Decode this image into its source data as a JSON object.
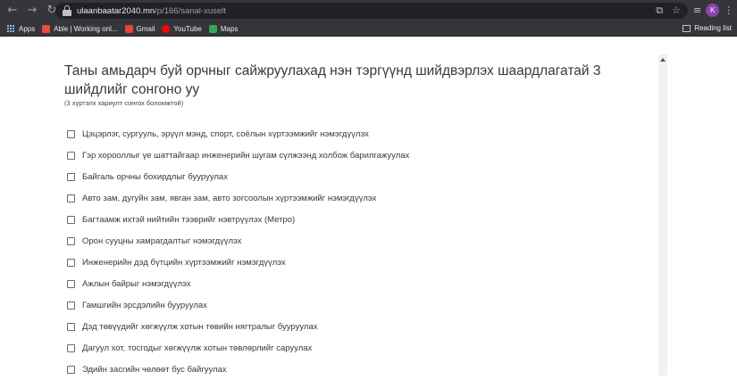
{
  "browser": {
    "url_host": "ulaanbaatar2040.mn",
    "url_path": "/p/166/sanal-xuselt",
    "profile_initial": "K",
    "bookmarks": [
      {
        "label": "Apps",
        "icon": "apps-grid-icon"
      },
      {
        "label": "Able | Working onl...",
        "icon": "able-icon",
        "color": "#e74c3c"
      },
      {
        "label": "Gmail",
        "icon": "gmail-icon",
        "color": "#ea4335"
      },
      {
        "label": "YouTube",
        "icon": "youtube-icon",
        "color": "#ff0000"
      },
      {
        "label": "Maps",
        "icon": "maps-icon",
        "color": "#34a853"
      }
    ],
    "reading_list": "Reading list"
  },
  "survey": {
    "question": "Таны амьдарч буй орчныг сайжруулахад нэн тэргүүнд шийдвэрлэх шаардлагатай 3 шийдлийг сонгоно уу",
    "hint": "(3 хүртэлх хариулт сонгох боломжтой)",
    "options": [
      "Цэцэрлэг, сургууль, эрүүл мэнд, спорт, соёлын хүртээмжийг нэмэгдүүлэх",
      "Гэр хорооллыг үе шаттайгаар инженерийн шугам сүлжээнд холбож барилгажуулах",
      "Байгаль орчны бохирдлыг бууруулах",
      "Авто зам, дугуйн зам, явган зам, авто зогсоолын хүртээмжийг нэмэгдүүлэх",
      "Багтаамж ихтэй нийтийн тээврийг нэвтрүүлэх (Метро)",
      "Орон сууцны хамрагдалтыг нэмэгдүүлэх",
      "Инженерийн дэд бүтцийн хүртээмжийг нэмэгдүүлэх",
      "Ажлын байрыг нэмэгдүүлэх",
      "Гамшгийн эрсдэлийн бууруулах",
      "Дэд төвүүдийг хөгжүүлж хотын төвийн нягтралыг бууруулах",
      "Дагуул хот, тосгодыг хөгжүүлж хотын төвлөрлийг саруулах",
      "Эдийн засгийн чөлөөт бус байгуулах"
    ]
  }
}
